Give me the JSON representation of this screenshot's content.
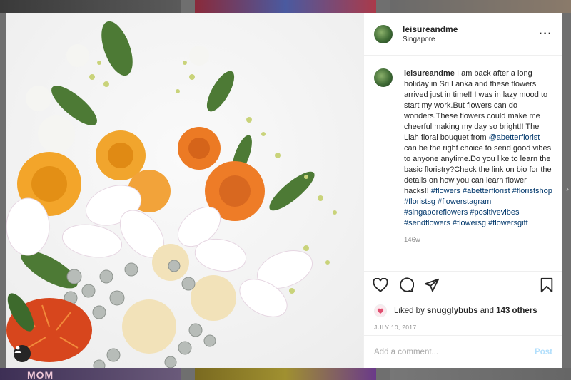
{
  "background": {
    "top_tiles": 3,
    "bottom_tile_text": "MOM"
  },
  "post": {
    "username": "leisureandme",
    "location": "Singapore",
    "more_icon": "more-horizontal-icon",
    "caption": {
      "username": "leisureandme",
      "text_before": " I am back after a long holiday in Sri Lanka and these flowers arrived just in time!! I was in lazy mood to start my work.But flowers can do wonders.These flowers could make me cheerful making my day so bright!! The Liah floral bouquet from ",
      "mention": "@abetterflorist",
      "text_after": " can be the right choice to send good vibes to anyone anytime.Do you like to learn the basic floristry?Check the link on bio for the details on how you can learn flower hacks!! ",
      "hashtags": [
        "#flowers",
        "#abetterflorist",
        "#floristshop",
        "#floristsg",
        "#flowerstagram",
        "#singaporeflowers",
        "#positivevibes",
        "#sendflowers",
        "#flowersg",
        "#flowersgift"
      ]
    },
    "time_ago": "146w",
    "likes": {
      "prefix": "Liked by ",
      "user": "snugglybubs",
      "middle": " and ",
      "count": "143 others"
    },
    "date": "JULY 10, 2017",
    "comment_placeholder": "Add a comment...",
    "post_label": "Post"
  },
  "icons": {
    "like": "heart-icon",
    "comment": "comment-icon",
    "share": "send-icon",
    "save": "bookmark-icon",
    "tag": "user-tag-icon"
  },
  "colors": {
    "link": "#00376b",
    "muted": "#8e8e8e",
    "post_disabled": "#b2dffc"
  }
}
